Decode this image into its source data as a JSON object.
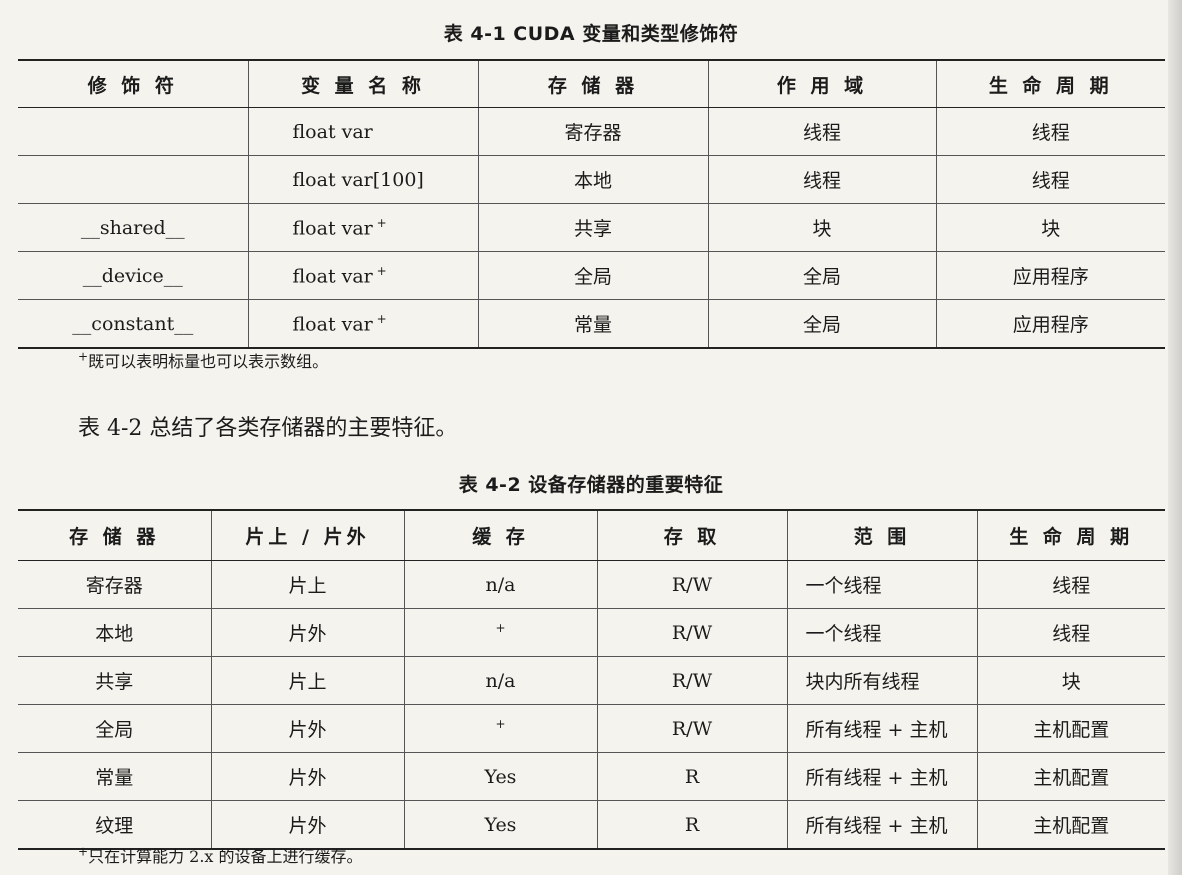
{
  "table1": {
    "caption": "表 4-1   CUDA 变量和类型修饰符",
    "headers": [
      "修 饰 符",
      "变 量 名 称",
      "存 储 器",
      "作 用 域",
      "生 命 周 期"
    ],
    "rows": [
      [
        "",
        "float var",
        "寄存器",
        "线程",
        "线程"
      ],
      [
        "",
        "float var[100]",
        "本地",
        "线程",
        "线程"
      ],
      [
        "__shared__",
        "float var +",
        "共享",
        "块",
        "块"
      ],
      [
        "__device__",
        "float var +",
        "全局",
        "全局",
        "应用程序"
      ],
      [
        "__constant__",
        "float var +",
        "常量",
        "全局",
        "应用程序"
      ]
    ],
    "footnote": "+既可以表明标量也可以表示数组。"
  },
  "body_text": "表 4-2 总结了各类存储器的主要特征。",
  "table2": {
    "caption": "表 4-2   设备存储器的重要特征",
    "headers": [
      "存 储 器",
      "片上 / 片外",
      "缓 存",
      "存 取",
      "范 围",
      "生 命 周 期"
    ],
    "rows": [
      [
        "寄存器",
        "片上",
        "n/a",
        "R/W",
        "一个线程",
        "线程"
      ],
      [
        "本地",
        "片外",
        "+",
        "R/W",
        "一个线程",
        "线程"
      ],
      [
        "共享",
        "片上",
        "n/a",
        "R/W",
        "块内所有线程",
        "块"
      ],
      [
        "全局",
        "片外",
        "+",
        "R/W",
        "所有线程 + 主机",
        "主机配置"
      ],
      [
        "常量",
        "片外",
        "Yes",
        "R",
        "所有线程 + 主机",
        "主机配置"
      ],
      [
        "纹理",
        "片外",
        "Yes",
        "R",
        "所有线程 + 主机",
        "主机配置"
      ]
    ],
    "footnote": "+只在计算能力 2.x 的设备上进行缓存。"
  }
}
